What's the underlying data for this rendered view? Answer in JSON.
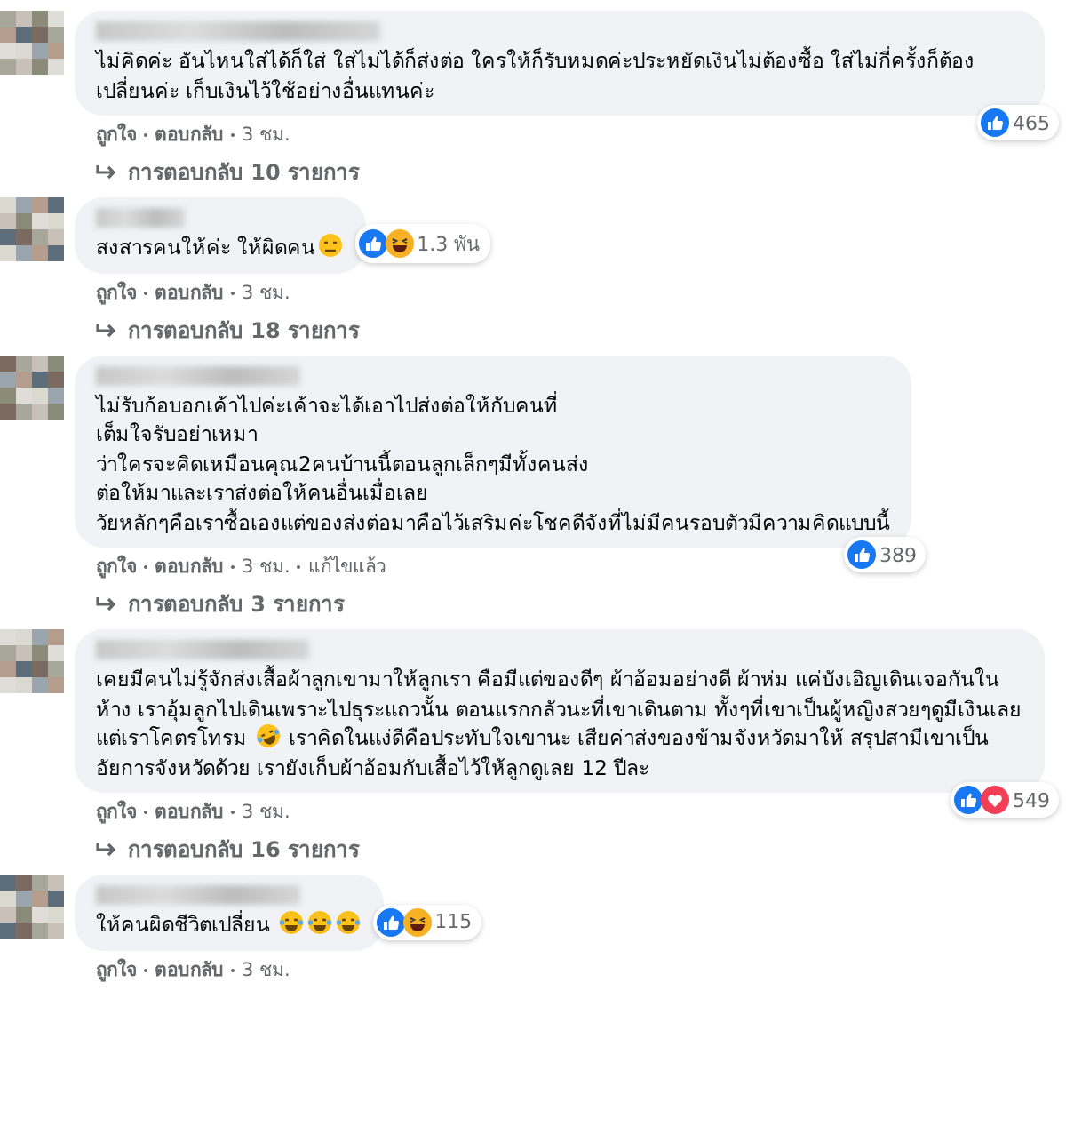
{
  "comments": [
    {
      "parts": [
        {
          "kind": "text",
          "text": "ไม่คิดค่ะ อันไหนใส่ได้ก็ใส่ ใส่ไม่ได้ก็ส่งต่อ ใครให้ก็รับหมดค่ะประหยัดเงินไม่ต้องซื้อ ใส่ไม่กี่ครั้งก็ต้องเปลี่ยนค่ะ เก็บเงินไว้ใช้อย่างอื่นแทนค่ะ"
        }
      ],
      "reactions": [
        {
          "kind": "like"
        }
      ],
      "reaction_count": "465",
      "actions": [
        "ถูกใจ",
        "ตอบกลับ"
      ],
      "time": "3 ชม.",
      "replies": "การตอบกลับ 10 รายการ"
    },
    {
      "parts": [
        {
          "kind": "text",
          "text": "สงสารคนให้ค่ะ ให้ผิดคน"
        },
        {
          "kind": "unamused"
        }
      ],
      "reactions": [
        {
          "kind": "like"
        },
        {
          "kind": "haha"
        }
      ],
      "reaction_count": "1.3 พัน",
      "actions": [
        "ถูกใจ",
        "ตอบกลับ"
      ],
      "time": "3 ชม.",
      "replies": "การตอบกลับ 18 รายการ"
    },
    {
      "parts": [
        {
          "kind": "text",
          "text": "ไม่รับก้อบอกเค้าไปค่ะเค้าจะได้เอาไปส่งต่อให้กับคนที่\nเต็มใจรับอย่าเหมา\nว่าใครจะคิดเหมือนคุณ2คนบ้านนี้ตอนลูกเล็กๆมีทั้งคนส่ง\nต่อให้มาและเราส่งต่อให้คนอื่นเมื่อเลย\nวัยหลักๆคือเราซื้อเองแต่ของส่งต่อมาคือไว้เสริมค่ะโชคดีจังที่ไม่มีคนรอบตัวมีความคิดแบบนี้"
        }
      ],
      "reactions": [
        {
          "kind": "like"
        }
      ],
      "reaction_count": "389",
      "actions": [
        "ถูกใจ",
        "ตอบกลับ"
      ],
      "time": "3 ชม.",
      "edited": "แก้ไขแล้ว",
      "replies": "การตอบกลับ 3 รายการ"
    },
    {
      "parts": [
        {
          "kind": "text",
          "text": "เคยมีคนไม่รู้จักส่งเสื้อผ้าลูกเขามาให้ลูกเรา คือมีแต่ของดีๆ ผ้าอ้อมอย่างดี ผ้าห่ม แค่บังเอิญเดินเจอกันในห้าง เราอุ้มลูกไปเดินเพราะไปธุระแถวนั้น ตอนแรกกลัวนะที่เขาเดินตาม ทั้งๆที่เขาเป็นผู้หญิงสวยๆดูมีเงินเลย แต่เราโคตรโทรม "
        },
        {
          "kind": "rofl"
        },
        {
          "kind": "text",
          "text": " เราคิดในแง่ดีคือประทับใจเขานะ เสียค่าส่งของข้ามจังหวัดมาให้ สรุปสามีเขาเป็นอัยการจังหวัดด้วย เรายังเก็บผ้าอ้อมกับเสื้อไว้ให้ลูกดูเลย 12 ปีละ"
        }
      ],
      "reactions": [
        {
          "kind": "like"
        },
        {
          "kind": "love"
        }
      ],
      "reaction_count": "549",
      "actions": [
        "ถูกใจ",
        "ตอบกลับ"
      ],
      "time": "3 ชม.",
      "replies": "การตอบกลับ 16 รายการ"
    },
    {
      "parts": [
        {
          "kind": "text",
          "text": "ให้คนผิดชีวิตเปลี่ยน "
        },
        {
          "kind": "joy"
        },
        {
          "kind": "joy"
        },
        {
          "kind": "joy"
        }
      ],
      "reactions": [
        {
          "kind": "like"
        },
        {
          "kind": "haha"
        }
      ],
      "reaction_count": "115",
      "actions": [
        "ถูกใจ",
        "ตอบกลับ"
      ],
      "time": "3 ชม."
    }
  ]
}
